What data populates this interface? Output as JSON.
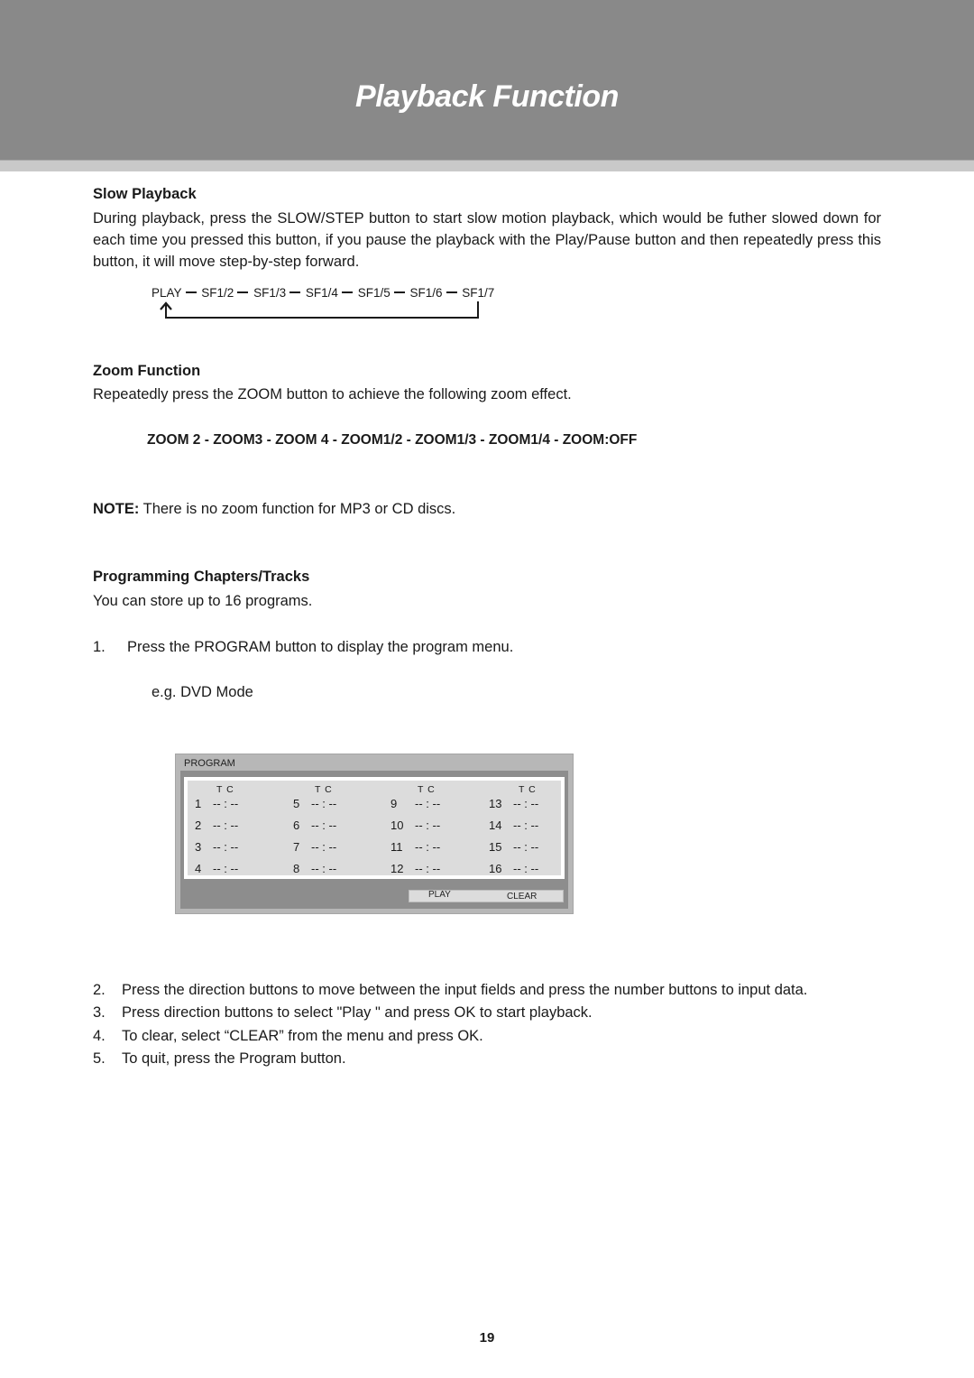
{
  "header": {
    "title": "Playback Function",
    "background_color": "#898989",
    "stripe_color": "#c9c9c9"
  },
  "slow_playback": {
    "heading": "Slow Playback",
    "body": "During playback, press the SLOW/STEP button to start slow motion playback, which would be futher slowed down for each time you pressed this button, if you pause the playback with the Play/Pause button and then repeatedly press this button, it will move step-by-step forward.",
    "sequence": [
      "PLAY",
      "SF1/2",
      "SF1/3",
      "SF1/4",
      "SF1/5",
      "SF1/6",
      "SF1/7"
    ],
    "loop_note": "arrow returns from SF1/7 to PLAY"
  },
  "zoom_function": {
    "heading": "Zoom Function",
    "body": "Repeatedly press the ZOOM button to achieve the following zoom effect.",
    "sequence_text": "ZOOM 2 - ZOOM3 - ZOOM 4 - ZOOM1/2 - ZOOM1/3 - ZOOM1/4 - ZOOM:OFF",
    "note_label": "NOTE:",
    "note_text": " There is no zoom function for MP3 or CD discs."
  },
  "programming": {
    "heading": "Programming Chapters/Tracks",
    "intro": "You can store up to 16 programs.",
    "step1": {
      "num": "1.",
      "text": "Press the PROGRAM button to display the program menu."
    },
    "example_label": "e.g. DVD Mode",
    "menu": {
      "title": "PROGRAM",
      "column_header": "T C",
      "columns": [
        {
          "slots": [
            {
              "index": "1",
              "value": "-- : --"
            },
            {
              "index": "2",
              "value": "-- : --"
            },
            {
              "index": "3",
              "value": "-- : --"
            },
            {
              "index": "4",
              "value": "-- : --"
            }
          ]
        },
        {
          "slots": [
            {
              "index": "5",
              "value": "-- : --"
            },
            {
              "index": "6",
              "value": "-- : --"
            },
            {
              "index": "7",
              "value": "-- : --"
            },
            {
              "index": "8",
              "value": "-- : --"
            }
          ]
        },
        {
          "slots": [
            {
              "index": "9",
              "value": "-- : --"
            },
            {
              "index": "10",
              "value": "-- : --"
            },
            {
              "index": "11",
              "value": "-- : --"
            },
            {
              "index": "12",
              "value": "-- : --"
            }
          ]
        },
        {
          "slots": [
            {
              "index": "13",
              "value": "-- : --"
            },
            {
              "index": "14",
              "value": "-- : --"
            },
            {
              "index": "15",
              "value": "-- : --"
            },
            {
              "index": "16",
              "value": "-- : --"
            }
          ]
        }
      ],
      "play_label": "PLAY",
      "clear_label": "CLEAR"
    },
    "steps": [
      {
        "num": "2.",
        "text": "Press the direction buttons to move between the input fields and press the number buttons to input data."
      },
      {
        "num": "3.",
        "text": "Press direction buttons to select \"Play \" and press OK to start playback."
      },
      {
        "num": "4.",
        "text": "To clear, select “CLEAR” from the menu and press OK."
      },
      {
        "num": "5.",
        "text": "To quit, press the Program button."
      }
    ]
  },
  "footer": {
    "page_number": "19"
  }
}
